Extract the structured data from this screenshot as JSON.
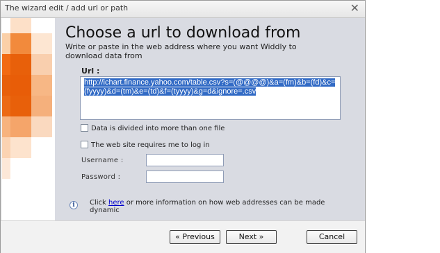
{
  "window": {
    "title": "The wizard edit / add url or path",
    "close_icon": "close-icon"
  },
  "header": {
    "title": "Choose a url to download from",
    "subtitle": "Write or paste in the web address where you want Widdly to download data from"
  },
  "url": {
    "label": "Url :",
    "value": "http://ichart.finance.yahoo.com/table.csv?s=(@@@@)&a=(fm)&b=(fd)&c=(fyyyy)&d=(tm)&e=(td)&f=(tyyyy)&g=d&ignore=.csv"
  },
  "options": {
    "multi_file_label": "Data is divided into more than one file",
    "multi_file_checked": false,
    "login_label": "The web site requires me to log in",
    "login_checked": false
  },
  "login": {
    "username_label": "Username :",
    "username_value": "",
    "password_label": "Password :",
    "password_value": ""
  },
  "info": {
    "icon": "info-icon",
    "prefix": "Click ",
    "link": "here",
    "suffix": " or more information on how web addresses can be made dynamic"
  },
  "footer": {
    "previous_label": "« Previous",
    "next_label": "Next »",
    "cancel_label": "Cancel"
  },
  "colors": {
    "panel": "#d9dbe2",
    "selection": "#316ac5",
    "accent_orange": "#e8600a"
  }
}
